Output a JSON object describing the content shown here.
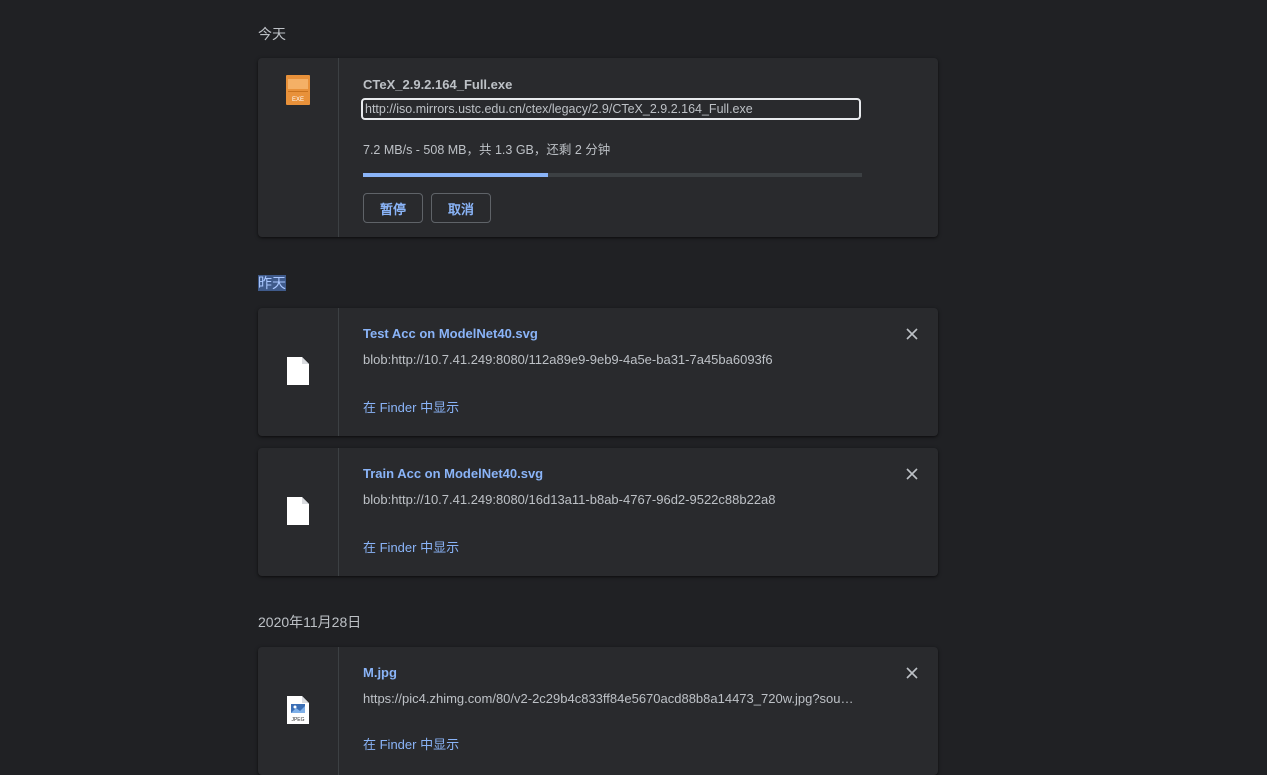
{
  "sections": {
    "today": "今天",
    "yesterday": "昨天",
    "date": "2020年11月28日"
  },
  "downloads": [
    {
      "filename": "CTeX_2.9.2.164_Full.exe",
      "url": "http://iso.mirrors.ustc.edu.cn/ctex/legacy/2.9/CTeX_2.9.2.164_Full.exe",
      "status": "7.2 MB/s - 508 MB，共 1.3 GB，还剩 2 分钟",
      "progress_percent": 37,
      "icon": "exe-file-icon",
      "icon_label": "EXE",
      "pause_label": "暂停",
      "cancel_label": "取消"
    },
    {
      "filename": "Test Acc on ModelNet40.svg",
      "url": "blob:http://10.7.41.249:8080/112a89e9-9eb9-4a5e-ba31-7a45ba6093f6",
      "action": "在 Finder 中显示",
      "icon": "generic-file-icon"
    },
    {
      "filename": "Train Acc on ModelNet40.svg",
      "url": "blob:http://10.7.41.249:8080/16d13a11-b8ab-4767-96d2-9522c88b22a8",
      "action": "在 Finder 中显示",
      "icon": "generic-file-icon"
    },
    {
      "filename": "M.jpg",
      "url": "https://pic4.zhimg.com/80/v2-2c29b4c833ff84e5670acd88b8a14473_720w.jpg?sou…",
      "action": "在 Finder 中显示",
      "icon": "jpeg-file-icon",
      "icon_label": "JPEG"
    }
  ],
  "colors": {
    "background": "#202124",
    "card": "#292a2d",
    "accent": "#8ab4f8",
    "text_secondary": "#bdc1c6"
  }
}
